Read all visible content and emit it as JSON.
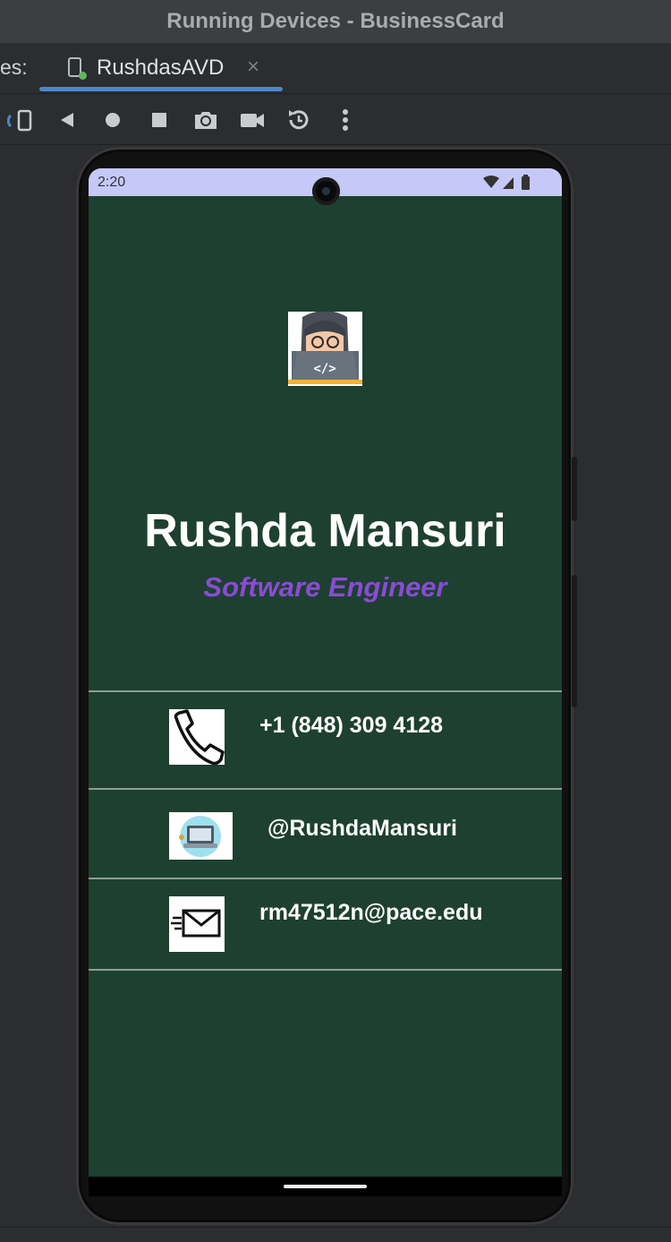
{
  "window": {
    "title": "Running Devices - BusinessCard"
  },
  "tabs": {
    "prefix": "es:",
    "active_label": "RushdasAVD",
    "close": "×"
  },
  "toolbar": {
    "buttons": [
      "rotate-icon",
      "back-icon",
      "home-icon",
      "overview-icon",
      "camera-icon",
      "screenrecord-icon",
      "reset-icon",
      "more-icon"
    ]
  },
  "device": {
    "status_time": "2:20",
    "status_icons": [
      "wifi-icon",
      "signal-icon",
      "battery-icon"
    ],
    "status_bar_color": "#c6c8f8"
  },
  "card": {
    "background": "#1e4030",
    "name": "Rushda Mansuri",
    "title": "Software Engineer",
    "title_color": "#8a4bd6",
    "contacts": [
      {
        "icon": "phone-icon",
        "text": "+1 (848) 309 4128"
      },
      {
        "icon": "laptop-icon",
        "text": "@RushdaMansuri"
      },
      {
        "icon": "email-icon",
        "text": "rm47512n@pace.edu"
      }
    ]
  }
}
